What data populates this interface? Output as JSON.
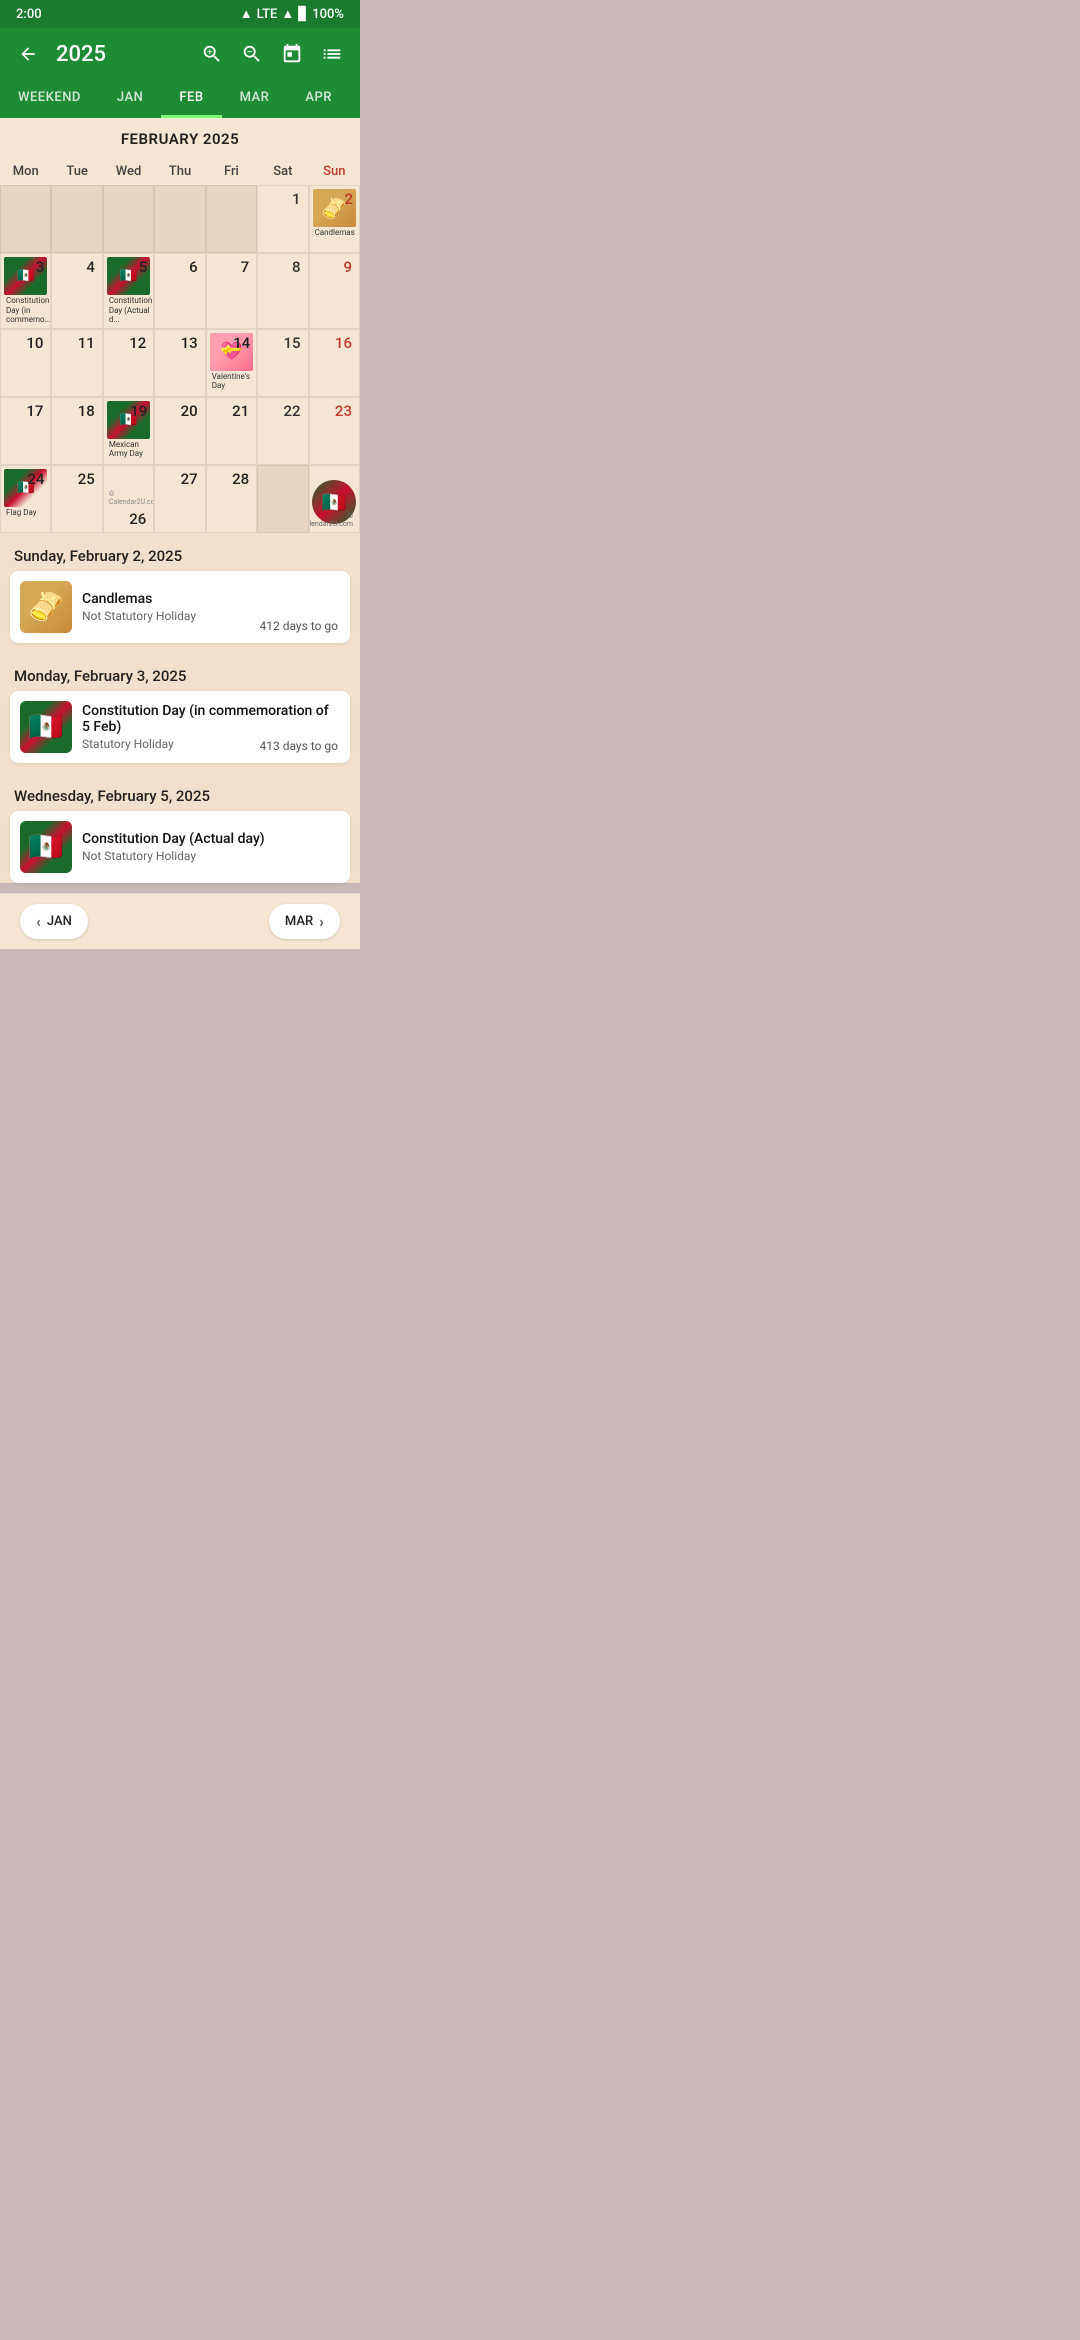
{
  "statusBar": {
    "time": "2:00",
    "signal": "LTE",
    "battery": "100%"
  },
  "toolbar": {
    "title": "2025",
    "backIcon": "←",
    "zoomInIcon": "zoom-in",
    "zoomOutIcon": "zoom-out",
    "calendarIcon": "calendar",
    "listIcon": "list"
  },
  "tabs": [
    {
      "id": "weekend",
      "label": "WEEKEND"
    },
    {
      "id": "jan",
      "label": "JAN"
    },
    {
      "id": "feb",
      "label": "FEB",
      "active": true
    },
    {
      "id": "mar",
      "label": "MAR"
    },
    {
      "id": "apr",
      "label": "APR"
    }
  ],
  "calendar": {
    "title": "FEBRUARY 2025",
    "dayHeaders": [
      "Mon",
      "Tue",
      "Wed",
      "Thu",
      "Fri",
      "Sat",
      "Sun"
    ],
    "copyright": "© Calendar2U.com"
  },
  "events": [
    {
      "dateHeader": "Sunday, February 2, 2025",
      "title": "Candlemas",
      "subtitle": "Not Statutory Holiday",
      "daysToGo": "412 days to go",
      "thumbType": "candlemas"
    },
    {
      "dateHeader": "Monday, February 3, 2025",
      "title": "Constitution Day (in commemoration of 5 Feb)",
      "subtitle": "Statutory Holiday",
      "daysToGo": "413 days to go",
      "thumbType": "constitution"
    },
    {
      "dateHeader": "Wednesday, February 5, 2025",
      "title": "Constitution Day (Actual day)",
      "subtitle": "Not Statutory Holiday",
      "daysToGo": "",
      "thumbType": "constitution"
    }
  ],
  "bottomNav": {
    "prevLabel": "JAN",
    "nextLabel": "MAR"
  }
}
